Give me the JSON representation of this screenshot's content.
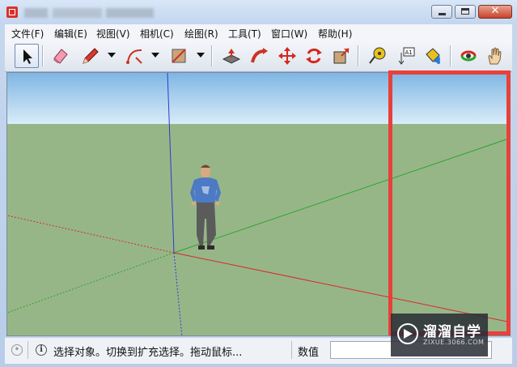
{
  "window": {
    "title": "",
    "close_symbol": "✕"
  },
  "menu": {
    "items": [
      "文件(F)",
      "编辑(E)",
      "视图(V)",
      "相机(C)",
      "绘图(R)",
      "工具(T)",
      "窗口(W)",
      "帮助(H)"
    ]
  },
  "toolbar": {
    "tools": [
      {
        "name": "select-icon",
        "active": true
      },
      {
        "name": "eraser-icon"
      },
      {
        "name": "pencil-icon"
      },
      {
        "name": "arc-icon"
      },
      {
        "name": "rectangle-icon"
      },
      {
        "name": "push-pull-icon"
      },
      {
        "name": "follow-me-icon"
      },
      {
        "name": "move-icon"
      },
      {
        "name": "rotate-icon"
      },
      {
        "name": "scale-icon"
      },
      {
        "name": "tape-measure-icon"
      },
      {
        "name": "text-icon"
      },
      {
        "name": "paint-bucket-icon"
      },
      {
        "name": "orbit-icon"
      },
      {
        "name": "pan-icon"
      }
    ],
    "text_tool_label": "A1"
  },
  "statusbar": {
    "message": "选择对象。切换到扩充选择。拖动鼠标...",
    "value_label": "数值",
    "value": ""
  },
  "watermark": {
    "title": "溜溜自学",
    "url": "ZIXUE.3066.COM"
  },
  "colors": {
    "annotation": "#e8403a",
    "sky_top": "#7fb6e3",
    "ground": "#97b688",
    "axis_red": "#d62a2a",
    "axis_green": "#2aa52a",
    "axis_blue": "#2a3ad6"
  }
}
